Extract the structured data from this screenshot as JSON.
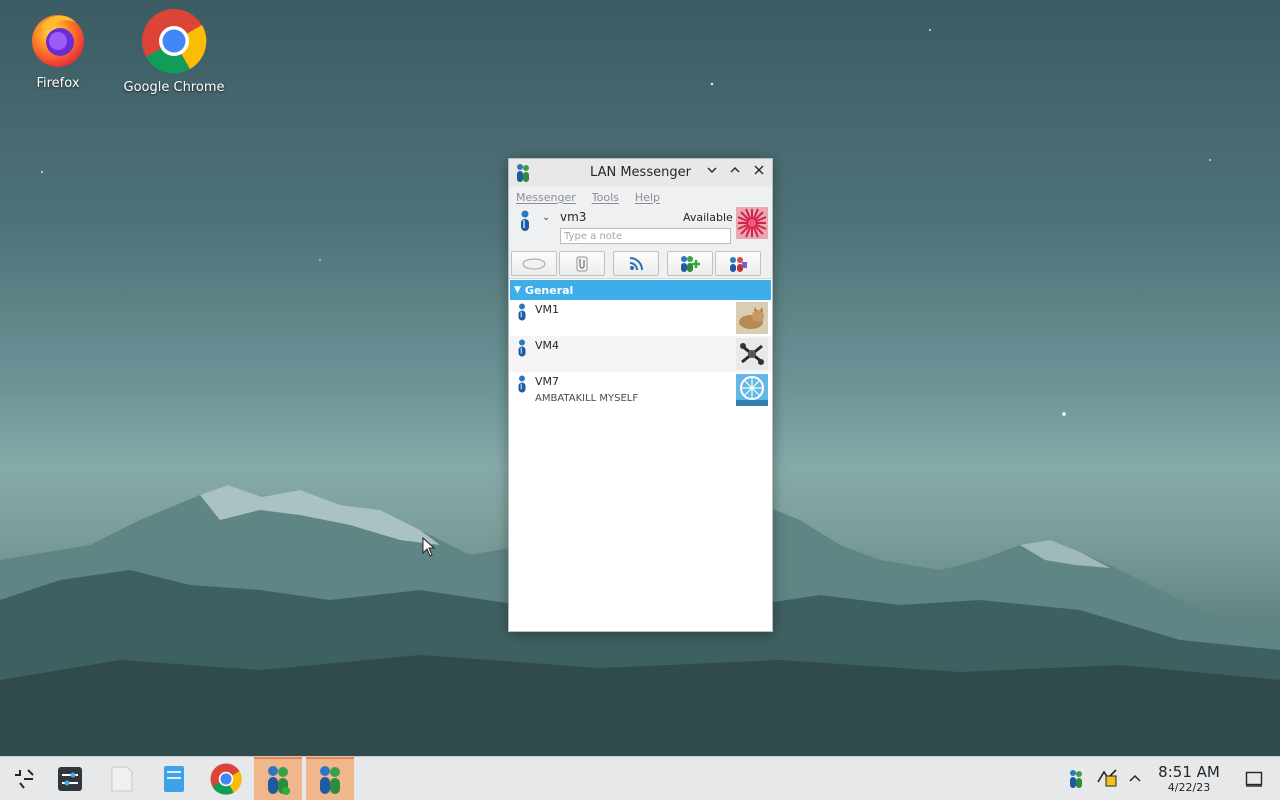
{
  "desktop": {
    "icons": [
      {
        "label": "Firefox"
      },
      {
        "label": "Google Chrome"
      }
    ]
  },
  "window": {
    "title": "LAN Messenger",
    "menu": [
      "Messenger",
      "Tools",
      "Help"
    ],
    "profile": {
      "username": "vm3",
      "status": "Available",
      "note_placeholder": "Type a note"
    },
    "group": "General",
    "contacts": [
      {
        "name": "VM1",
        "note": ""
      },
      {
        "name": "VM4",
        "note": ""
      },
      {
        "name": "VM7",
        "note": "AMBATAKILL MYSELF"
      }
    ]
  },
  "taskbar": {
    "time": "8:51 AM",
    "date": "4/22/23"
  },
  "colors": {
    "selection": "#3daee9",
    "taskbar_active": "#f1b78c"
  }
}
